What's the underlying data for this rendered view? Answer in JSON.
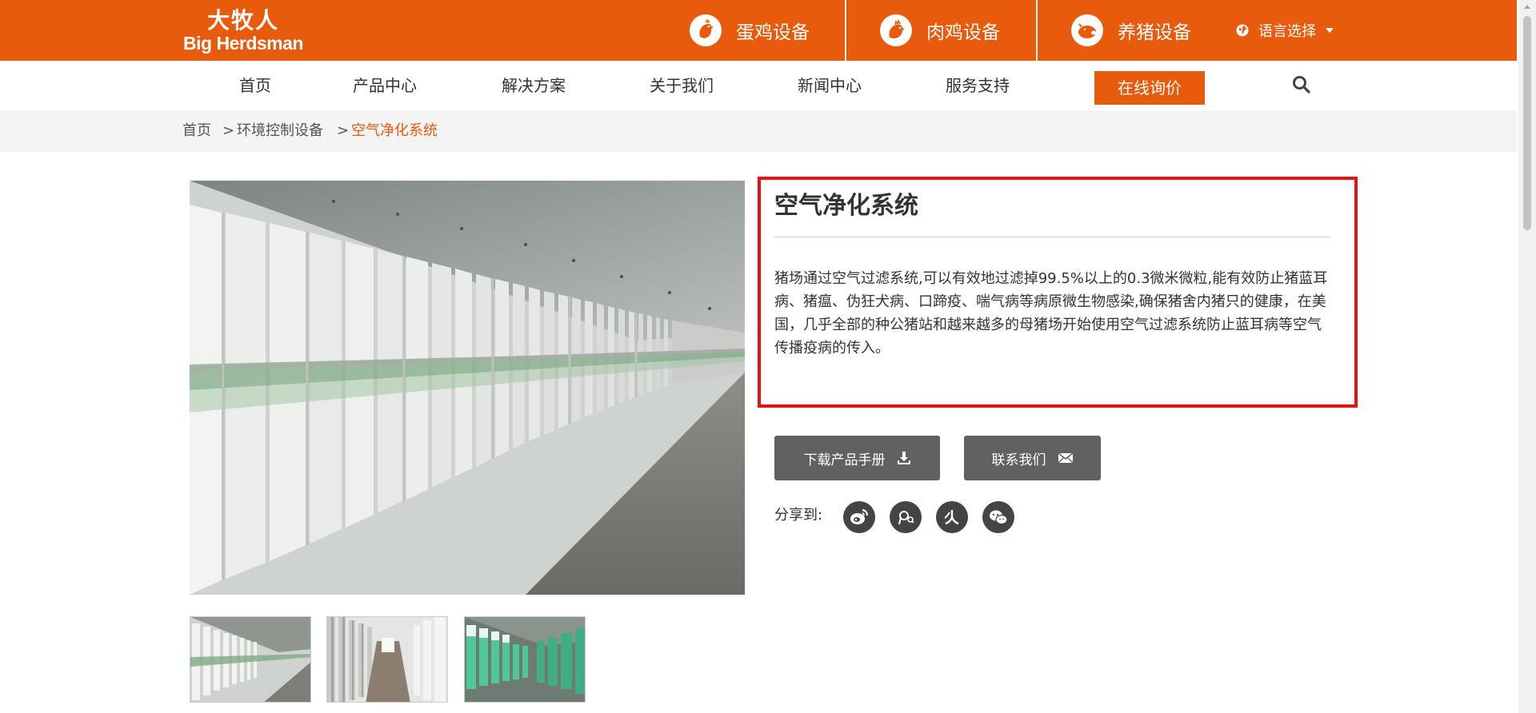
{
  "brand": {
    "name_cn": "大牧人",
    "name_en": "Big Herdsman"
  },
  "header": {
    "categories": [
      {
        "label": "蛋鸡设备",
        "icon": "chicken-icon"
      },
      {
        "label": "肉鸡设备",
        "icon": "rooster-icon"
      },
      {
        "label": "养猪设备",
        "icon": "pig-icon"
      }
    ],
    "language": {
      "label": "语言选择",
      "icon": "globe-icon"
    }
  },
  "nav": {
    "items": [
      "首页",
      "产品中心",
      "解决方案",
      "关于我们",
      "新闻中心",
      "服务支持"
    ],
    "inquiry_label": "在线询价",
    "search_icon": "search-icon"
  },
  "breadcrumb": {
    "home": "首页",
    "sep1": ">",
    "category": "环境控制设备",
    "sep2": ">",
    "current": "空气净化系统"
  },
  "product": {
    "title": "空气净化系统",
    "description": "猪场通过空气过滤系统,可以有效地过滤掉99.5%以上的0.3微米微粒,能有效防止猪蓝耳病、猪瘟、伪狂犬病、口蹄疫、喘气病等病原微生物感染,确保猪舍内猪只的健康，在美国，几乎全部的种公猪站和越来越多的母猪场开始使用空气过滤系统防止蓝耳病等空气传播疫病的传入。",
    "download_label": "下载产品手册",
    "contact_label": "联系我们",
    "share_label": "分享到:",
    "share_icons": [
      "weibo-icon",
      "tencent-weibo-icon",
      "renren-icon",
      "wechat-icon"
    ]
  },
  "colors": {
    "brand_orange": "#e85a0c",
    "highlight_red": "#e81010",
    "button_gray": "#616161"
  }
}
